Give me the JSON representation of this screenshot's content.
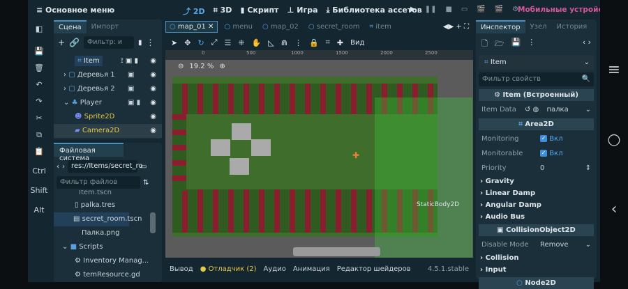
{
  "topbar": {
    "menu": "≡ Основное меню",
    "modes": [
      {
        "label": "⤴ 2D",
        "active": true
      },
      {
        "label": "⌗ 3D"
      },
      {
        "label": "▮ Скрипт"
      },
      {
        "label": "⊥ Игра"
      },
      {
        "label": "⤓ Библиотека ассетов"
      }
    ],
    "play_icons": [
      "▶",
      "❚❚",
      "■",
      "▭",
      "🎬",
      "🎬",
      "⚙"
    ],
    "mobile": "Мобильные устройств"
  },
  "left_toolbar": {
    "keys": [
      "Ctrl",
      "Shift",
      "Alt"
    ]
  },
  "scene": {
    "tabs": [
      "Сцена",
      "Импорт"
    ],
    "filter_placeholder": "Фильтр: и",
    "nodes": [
      {
        "label": "Item",
        "icons": "⟟ ▣ ▮"
      },
      {
        "label": "Деревья 1",
        "icons": "▣"
      },
      {
        "label": "Деревья 2",
        "icons": "▣"
      },
      {
        "label": "Player",
        "icons": "▣ ▮"
      },
      {
        "label": "Sprite2D",
        "icons": ""
      },
      {
        "label": "Camera2D",
        "icons": ""
      }
    ]
  },
  "filesystem": {
    "title": "Файловая система",
    "path": "res://Items/secret_ro",
    "filter_placeholder": "Фильтр файлов",
    "items": [
      "Item.tscn",
      "palka.tres",
      "secret_room.tscn",
      "Палка.png",
      "Scripts",
      "Inventory Manag...",
      "temResource.gd"
    ]
  },
  "viewport": {
    "tabs": [
      "map_01",
      "menu",
      "map_02",
      "secret_room",
      "item"
    ],
    "view_label": "Вид",
    "zoom": "19.2 %",
    "ruler": [
      "0",
      "500",
      "1000",
      "1500",
      "2000",
      "2500"
    ],
    "node_label": "StaticBody2D"
  },
  "bottom": {
    "tabs": [
      "Вывод",
      "Отладчик (2)",
      "Аудио",
      "Анимация",
      "Редактор шейдеров"
    ],
    "version": "4.5.1.stable"
  },
  "inspector": {
    "tabs": [
      "Инспектор",
      "Узел",
      "История"
    ],
    "object": "Item",
    "filter_placeholder": "Фильтр свойств",
    "sections": {
      "item": "Item (Встроенный)",
      "area": "Area2D",
      "collision": "CollisionObject2D",
      "node2d": "Node2D"
    },
    "item_data_label": "Item Data",
    "item_data_value": "палка",
    "monitoring_label": "Monitoring",
    "monitorable_label": "Monitorable",
    "on": "Вкл",
    "priority_label": "Priority",
    "priority_value": "0",
    "groups": [
      "Gravity",
      "Linear Damp",
      "Angular Damp",
      "Audio Bus"
    ],
    "disable_mode_label": "Disable Mode",
    "disable_mode_value": "Remove",
    "groups2": [
      "Collision",
      "Input"
    ]
  },
  "colors": {
    "accent": "#58a6e8",
    "mobile": "#d8569a",
    "warning": "#e8c84a"
  }
}
